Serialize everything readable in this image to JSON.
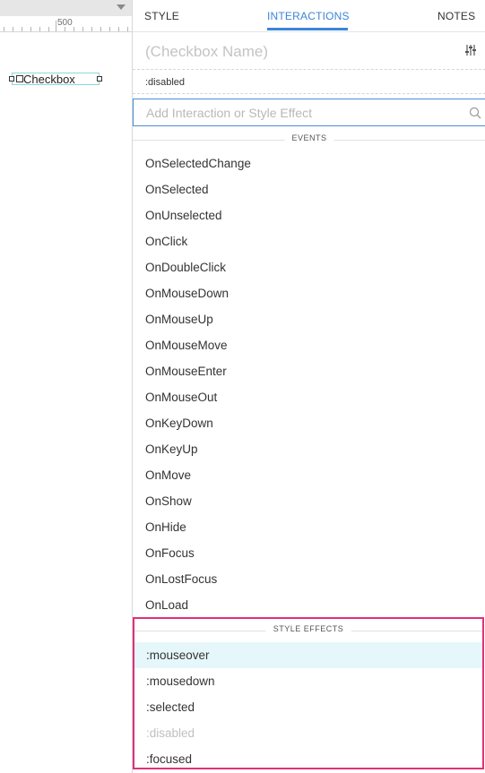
{
  "canvas": {
    "ruler_label": "500",
    "widget_label": "Checkbox"
  },
  "tabs": {
    "style": "STYLE",
    "interactions": "INTERACTIONS",
    "notes": "NOTES"
  },
  "widget_name_placeholder": "(Checkbox Name)",
  "state_label": ":disabled",
  "search": {
    "placeholder": "Add Interaction or Style Effect",
    "value": ""
  },
  "events": {
    "header": "EVENTS",
    "items": [
      "OnSelectedChange",
      "OnSelected",
      "OnUnselected",
      "OnClick",
      "OnDoubleClick",
      "OnMouseDown",
      "OnMouseUp",
      "OnMouseMove",
      "OnMouseEnter",
      "OnMouseOut",
      "OnKeyDown",
      "OnKeyUp",
      "OnMove",
      "OnShow",
      "OnHide",
      "OnFocus",
      "OnLostFocus",
      "OnLoad"
    ]
  },
  "style_effects": {
    "header": "STYLE EFFECTS",
    "items": [
      ":mouseover",
      ":mousedown",
      ":selected",
      ":disabled",
      ":focused"
    ],
    "highlighted": ":mouseover",
    "disabled_item": ":disabled"
  },
  "colors": {
    "accent": "#3b86d8",
    "highlight_border": "#e0307a",
    "hover_bg": "#e5f7fa"
  }
}
